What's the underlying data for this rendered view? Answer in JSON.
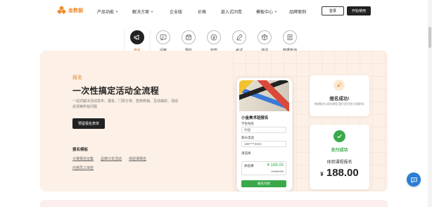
{
  "brand": {
    "name": "金数据",
    "accent": "#f08a2a"
  },
  "nav": {
    "items": [
      {
        "label": "产品功能",
        "has_caret": true
      },
      {
        "label": "解决方案",
        "has_caret": true
      },
      {
        "label": "企业版",
        "has_caret": false
      },
      {
        "label": "价格",
        "has_caret": false
      },
      {
        "label": "嵌入式问卷",
        "has_caret": false
      },
      {
        "label": "模板中心",
        "has_caret": true
      },
      {
        "label": "品牌案例",
        "has_caret": false
      }
    ],
    "login_label": "登录",
    "trial_label": "开始使用"
  },
  "tabs": [
    {
      "label": "报名",
      "icon": "megaphone-icon",
      "active": true
    },
    {
      "label": "问卷",
      "icon": "chat-form-icon",
      "active": false
    },
    {
      "label": "预约",
      "icon": "calendar-icon",
      "active": false
    },
    {
      "label": "收款",
      "icon": "yuan-icon",
      "active": false
    },
    {
      "label": "考试",
      "icon": "pen-icon",
      "active": false
    },
    {
      "label": "测评",
      "icon": "cube-icon",
      "active": false
    },
    {
      "label": "数据查询",
      "icon": "data-query-icon",
      "active": false
    }
  ],
  "panel": {
    "tag": "报名",
    "title": "一次性搞定活动全流程",
    "desc": "一站式解决活动发布、报名、门票订单、签到核销、互动抽奖、活动反馈等所有问题",
    "cta": "预留报名表单",
    "templates_title": "报名模板",
    "templates": [
      "大赛报名征集",
      "品牌沙龙活动",
      "体验课报名",
      "内部员工体检"
    ]
  },
  "phone": {
    "form_title": "小金美术班报名",
    "student_label": "学生姓名",
    "student_value": "孙强",
    "phone_label": "家长电话",
    "phone_value": "188****3310",
    "course_label": "请选择",
    "course_name": "体验课",
    "price": "¥ 188.00",
    "old_price": "¥ 388.00",
    "pay_label": "报名付款"
  },
  "card_success": {
    "title": "报名成功!",
    "sub": "感谢报名,体验课程,我们会尽快与您联系!"
  },
  "card_pay": {
    "status": "支付成功",
    "course": "体验课程报名",
    "currency": "¥",
    "amount": "188.00"
  }
}
